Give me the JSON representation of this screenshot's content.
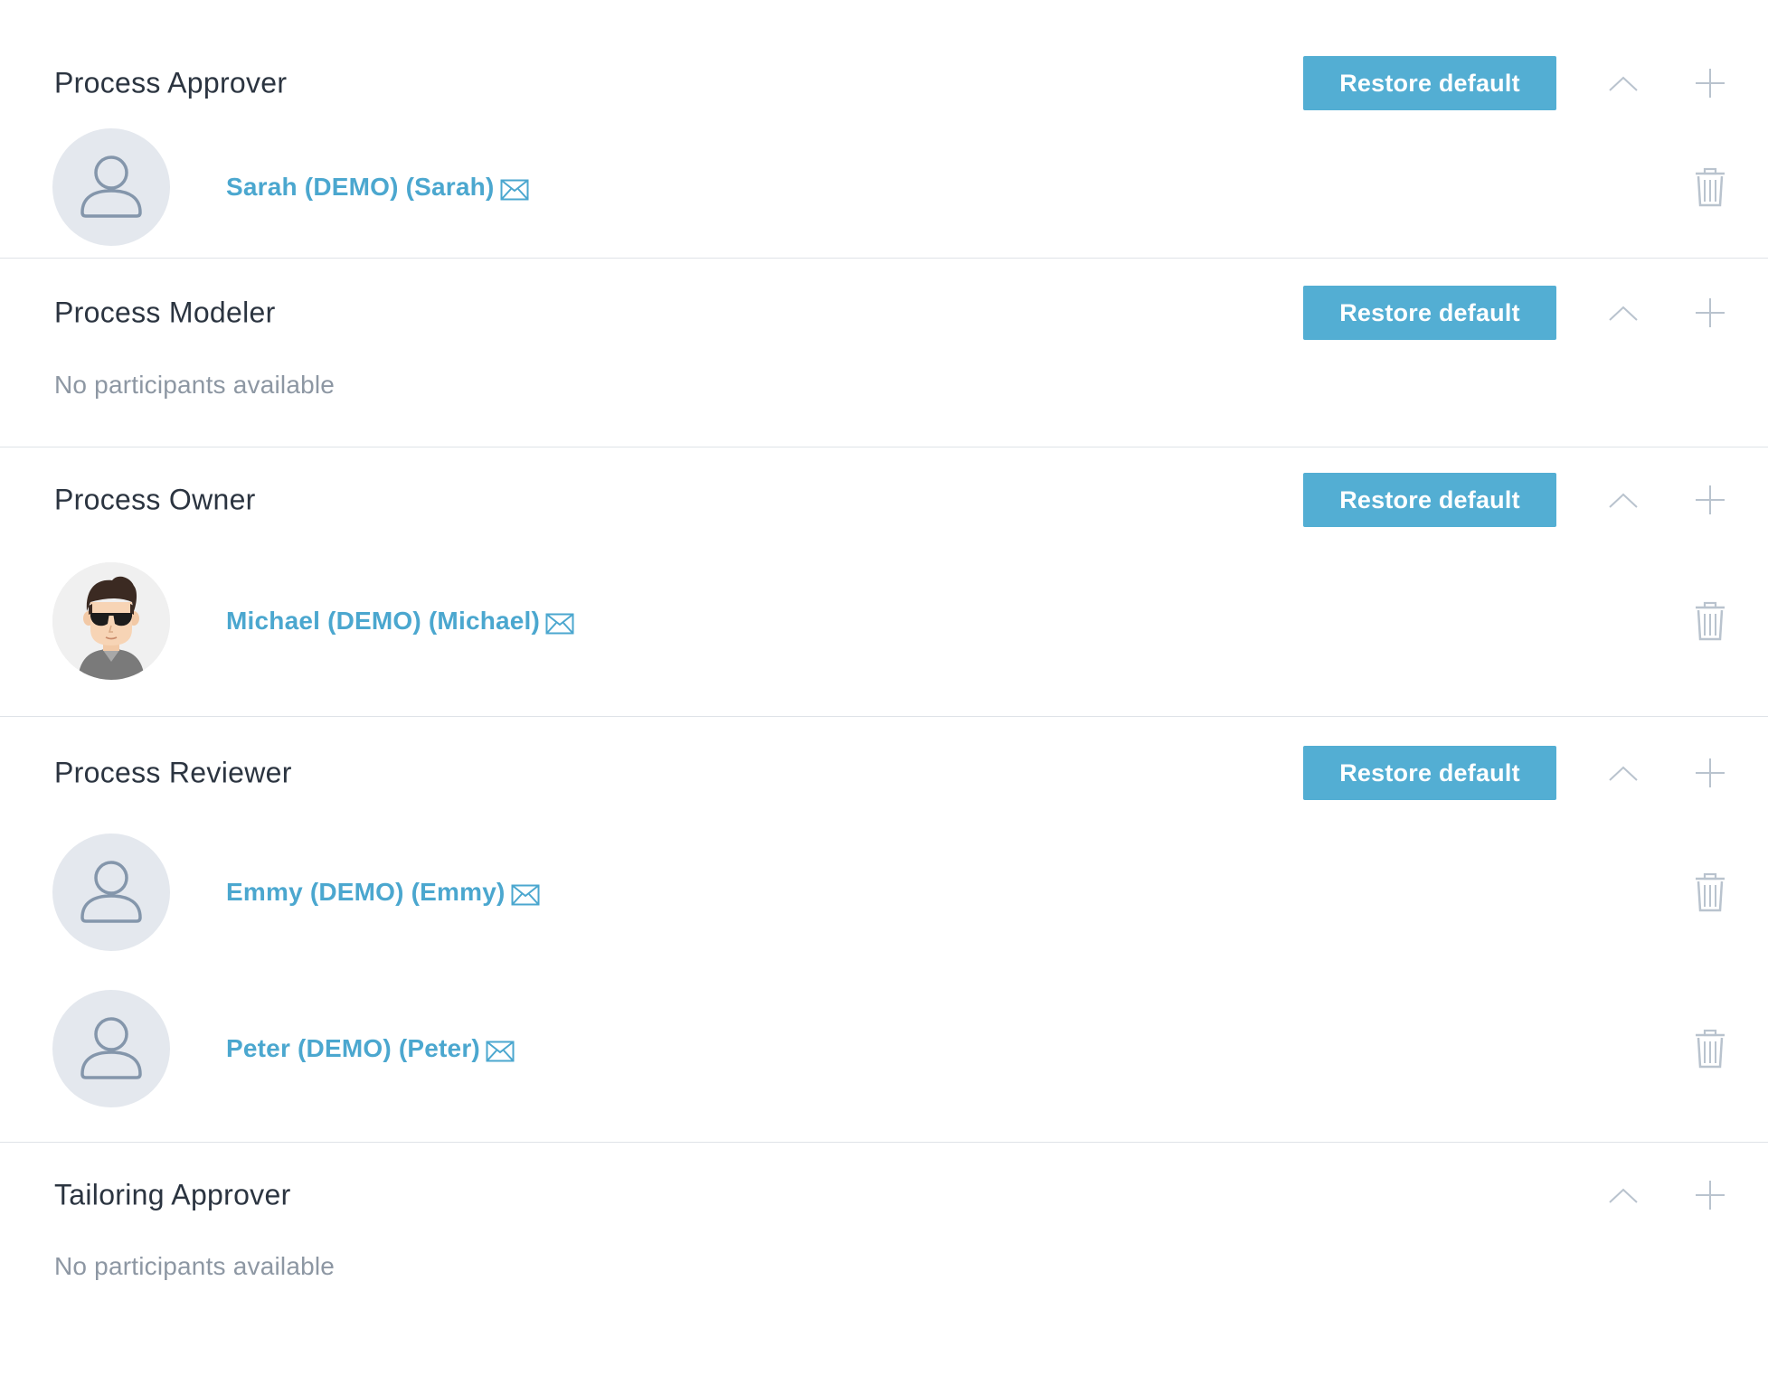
{
  "roles": [
    {
      "title": "Process Approver",
      "restore_label": "Restore default",
      "show_restore": true,
      "participants": [
        {
          "name": "Sarah (DEMO) (Sarah)",
          "avatar": "placeholder-user-icon"
        }
      ],
      "empty_text": ""
    },
    {
      "title": "Process Modeler",
      "restore_label": "Restore default",
      "show_restore": true,
      "participants": [],
      "empty_text": "No participants available"
    },
    {
      "title": "Process Owner",
      "restore_label": "Restore default",
      "show_restore": true,
      "participants": [
        {
          "name": "Michael (DEMO) (Michael)",
          "avatar": "cartoon-man-sunglasses-photo"
        }
      ],
      "empty_text": ""
    },
    {
      "title": "Process Reviewer",
      "restore_label": "Restore default",
      "show_restore": true,
      "participants": [
        {
          "name": "Emmy (DEMO) (Emmy)",
          "avatar": "placeholder-user-icon"
        },
        {
          "name": "Peter (DEMO) (Peter)",
          "avatar": "placeholder-user-icon"
        }
      ],
      "empty_text": ""
    },
    {
      "title": "Tailoring Approver",
      "restore_label": "",
      "show_restore": false,
      "participants": [],
      "empty_text": "No participants available"
    }
  ],
  "icons": {
    "collapse": "chevron-up-icon",
    "add": "plus-icon",
    "mail": "envelope-icon",
    "delete": "trash-icon"
  },
  "colors": {
    "accent": "#53aed3",
    "link": "#4ba7cf",
    "icon_muted": "#b9c3ce",
    "divider": "#dfe3e8",
    "avatar_bg": "#e4e8ee",
    "avatar_figure": "#8496ab"
  }
}
